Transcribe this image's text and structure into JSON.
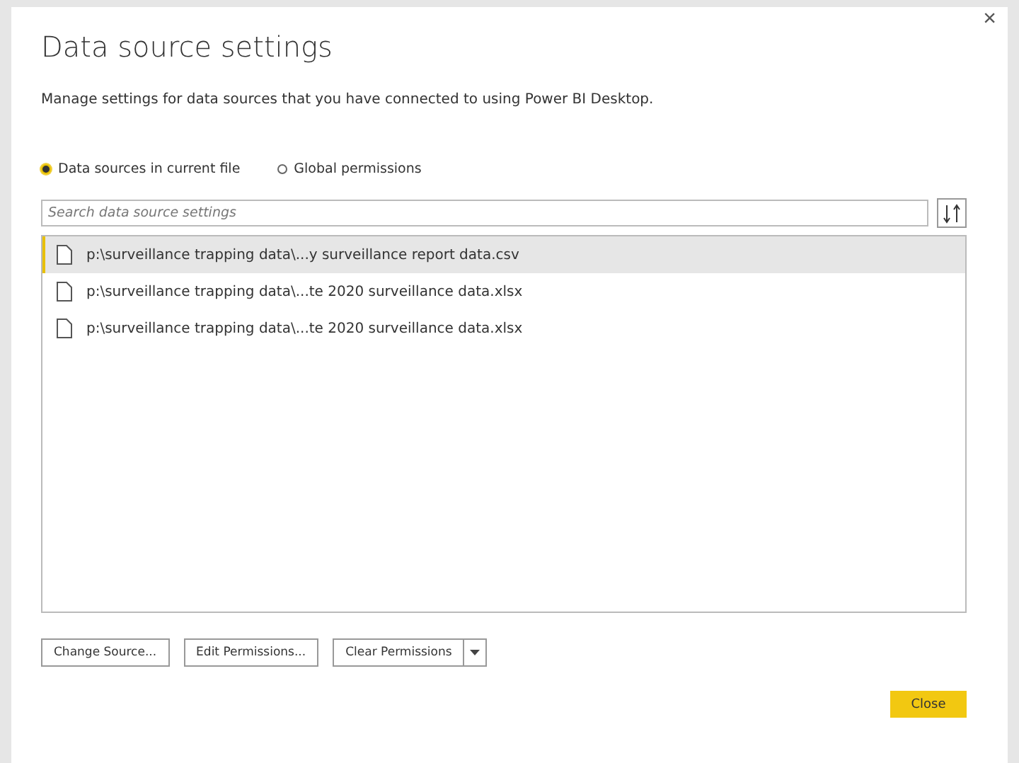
{
  "window": {
    "title": "Data source settings",
    "close": "×"
  },
  "description": "Manage settings for data sources that you have connected to using Power BI Desktop.",
  "scope_options": [
    {
      "label": "Data sources in current file",
      "selected": true
    },
    {
      "label": "Global permissions",
      "selected": false
    }
  ],
  "search": {
    "placeholder": "Search data source settings"
  },
  "sources": [
    {
      "path": "p:\\surveillance trapping data\\...y surveillance report data.csv",
      "selected": true
    },
    {
      "path": "p:\\surveillance trapping data\\...te 2020 surveillance data.xlsx",
      "selected": false
    },
    {
      "path": "p:\\surveillance trapping data\\...te 2020 surveillance data.xlsx",
      "selected": false
    }
  ],
  "actions": [
    {
      "label": "Change Source...",
      "kind": "plain"
    },
    {
      "label": "Edit Permissions...",
      "kind": "plain"
    },
    {
      "label": "Clear Permissions",
      "kind": "split"
    }
  ],
  "close_button": "Close"
}
